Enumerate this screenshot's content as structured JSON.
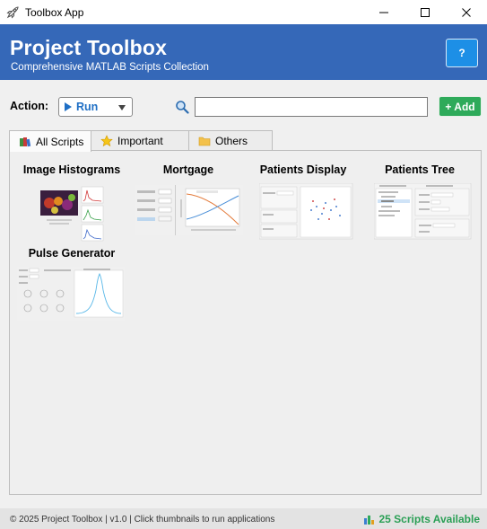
{
  "window": {
    "title": "Toolbox App",
    "minimize_icon": "minimize-icon",
    "maximize_icon": "maximize-icon",
    "close_icon": "close-icon"
  },
  "header": {
    "title": "Project Toolbox",
    "subtitle": "Comprehensive MATLAB Scripts Collection",
    "help_label": "?",
    "brand_color": "#3568b8"
  },
  "toolbar": {
    "action_label": "Action:",
    "action_value": "Run",
    "search_value": "",
    "search_placeholder": "",
    "add_label": "+ Add",
    "add_color": "#2eaa5a"
  },
  "tabs": [
    {
      "label": "All Scripts",
      "icon": "books-icon",
      "active": true
    },
    {
      "label": "Important",
      "icon": "star-icon",
      "active": false
    },
    {
      "label": "Others",
      "icon": "folder-icon",
      "active": false
    }
  ],
  "scripts": [
    {
      "title": "Image Histograms"
    },
    {
      "title": "Mortgage"
    },
    {
      "title": "Patients Display"
    },
    {
      "title": "Patients Tree"
    },
    {
      "title": "Pulse Generator"
    }
  ],
  "footer": {
    "text": "© 2025 Project Toolbox | v1.0 | Click thumbnails to run applications",
    "count_text": "25 Scripts Available",
    "count_color": "#2a9f55"
  }
}
